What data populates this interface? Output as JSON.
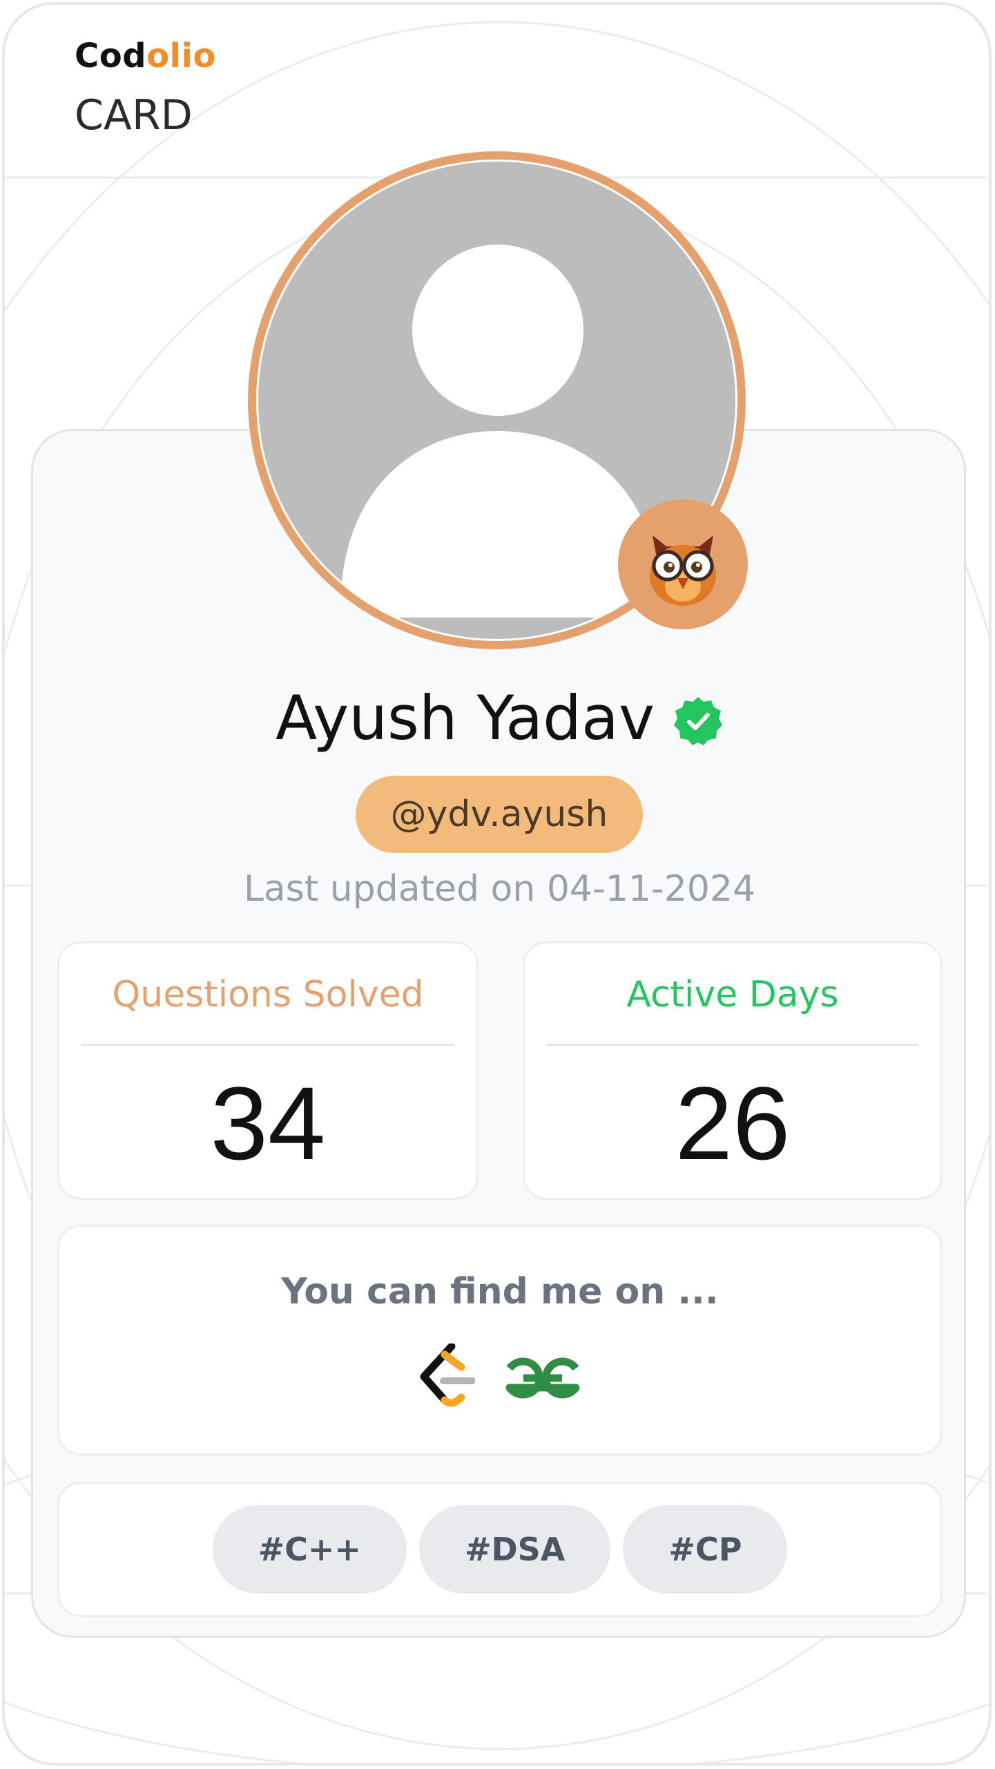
{
  "brand": {
    "name_part1": "Cod",
    "name_part2": "olio",
    "subtitle": "CARD"
  },
  "colors": {
    "brand_accent": "#f28c28",
    "avatar_ring": "#e4a06d",
    "handle_bg": "#f2bb7b",
    "questions_color": "#e4a06d",
    "active_color": "#22c55e",
    "verified_color": "#22c55e",
    "geeksforgeeks_color": "#2f8d46"
  },
  "profile": {
    "avatar_icon": "default-user-avatar",
    "badge_icon": "owl-with-glasses-icon",
    "name": "Ayush Yadav",
    "verified_icon": "verified-badge-icon",
    "handle": "@ydv.ayush",
    "last_updated": "Last updated on 04-11-2024"
  },
  "stats": [
    {
      "label": "Questions Solved",
      "value": "34"
    },
    {
      "label": "Active Days",
      "value": "26"
    }
  ],
  "find_me": {
    "title": "You can find me on ...",
    "platforms": [
      {
        "icon": "leetcode-icon"
      },
      {
        "icon": "geeksforgeeks-icon"
      }
    ]
  },
  "tags": [
    "#C++",
    "#DSA",
    "#CP"
  ]
}
